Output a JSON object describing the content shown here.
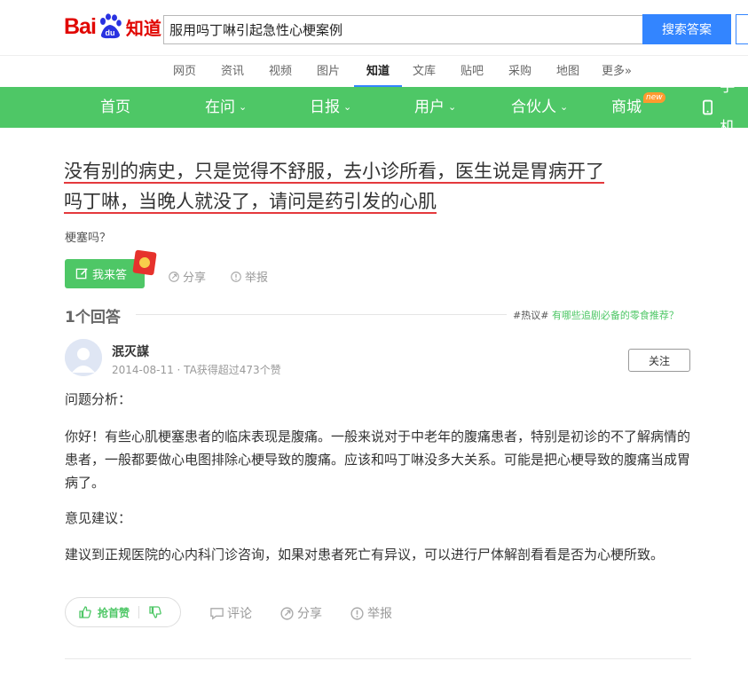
{
  "header": {
    "logo": {
      "bai": "Bai",
      "paw": "du",
      "zhidao": "知道"
    },
    "search": {
      "value": "服用吗丁啉引起急性心梗案例",
      "button_label": "搜索答案"
    }
  },
  "subnav": {
    "items": [
      "网页",
      "资讯",
      "视频",
      "图片",
      "知道",
      "文库",
      "贴吧",
      "采购",
      "地图",
      "更多»"
    ],
    "active": "知道"
  },
  "green_nav": {
    "items": [
      {
        "label": "首页",
        "has_dropdown": false
      },
      {
        "label": "在问",
        "has_dropdown": true
      },
      {
        "label": "日报",
        "has_dropdown": true
      },
      {
        "label": "用户",
        "has_dropdown": true
      },
      {
        "label": "合伙人",
        "has_dropdown": true
      },
      {
        "label": "商城",
        "has_dropdown": false
      },
      {
        "label": "手机",
        "has_dropdown": false
      }
    ],
    "new_badge": "new",
    "chevron": "⌄"
  },
  "question": {
    "title_line1": "没有别的病史，只是觉得不舒服，去小诊所看，医生说是胃病开了",
    "title_line2": "吗丁啉，当晚人就没了，请问是药引发的心肌",
    "description": "梗塞吗？",
    "answer_button": "我来答",
    "share": "分享",
    "report": "举报"
  },
  "answers": {
    "count_label": "1个回答",
    "hot_prefix": "#热议#",
    "hot_link": "有哪些追剧必备的零食推荐？"
  },
  "answer": {
    "username": "泯灭謀",
    "meta": "2014-08-11 · TA获得超过473个赞",
    "follow": "关注",
    "paragraphs": [
      "问题分析：",
      "你好！有些心肌梗塞患者的临床表现是腹痛。一般来说对于中老年的腹痛患者，特别是初诊的不了解病情的患者，一般都要做心电图排除心梗导致的腹痛。应该和吗丁啉没多大关系。可能是把心梗导致的腹痛当成胃病了。",
      "意见建议：",
      "建议到正规医院的心内科门诊咨询，如果对患者死亡有异议，可以进行尸体解剖看看是否为心梗所致。"
    ],
    "vote_up": "抢首赞",
    "comment": "评论",
    "share": "分享",
    "report": "举报"
  },
  "colors": {
    "brand_red": "#e10601",
    "green": "#4ec766",
    "blue": "#3385ff"
  }
}
